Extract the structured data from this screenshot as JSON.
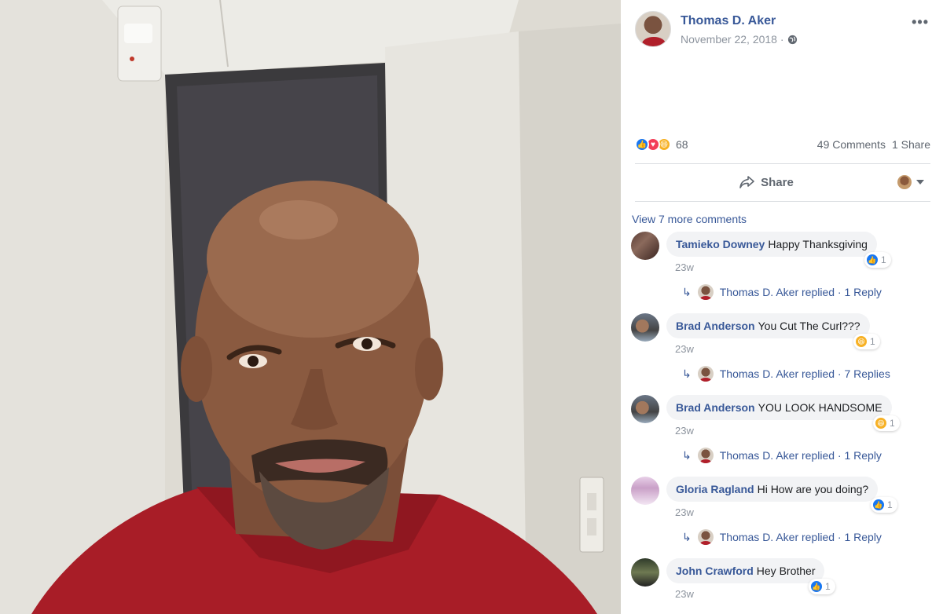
{
  "post": {
    "author": "Thomas D. Aker",
    "date": "November 22, 2018 ·",
    "more_label": "•••",
    "reaction_count": "68",
    "comments_count": "49 Comments",
    "shares_count": "1 Share",
    "share_label": "Share"
  },
  "comments_section": {
    "view_more": "View 7 more comments",
    "items": [
      {
        "name": "Tamieko Downey",
        "text": "Happy Thanksgiving",
        "time": "23w",
        "reaction": "like",
        "reaction_count": "1",
        "reply_text": "Thomas D. Aker replied · 1 Reply"
      },
      {
        "name": "Brad Anderson",
        "text": "You Cut The Curl???",
        "time": "23w",
        "reaction": "haha",
        "reaction_count": "1",
        "reply_text": "Thomas D. Aker replied · 7 Replies"
      },
      {
        "name": "Brad Anderson",
        "text": "YOU LOOK HANDSOME",
        "time": "23w",
        "reaction": "haha",
        "reaction_count": "1",
        "reply_text": "Thomas D. Aker replied · 1 Reply"
      },
      {
        "name": "Gloria Ragland",
        "text": "Hi How are you doing?",
        "time": "23w",
        "reaction": "like",
        "reaction_count": "1",
        "reply_text": "Thomas D. Aker replied · 1 Reply"
      },
      {
        "name": "John Crawford",
        "text": "Hey Brother",
        "time": "23w",
        "reaction": "like",
        "reaction_count": "1"
      }
    ]
  },
  "colors": {
    "link_blue": "#385898",
    "like_blue": "#1877f2",
    "love_red": "#f33e58",
    "haha_yellow": "#f7b125",
    "shirt_red": "#b01f2a"
  },
  "icons": [
    "globe-icon",
    "more-icon",
    "like-icon",
    "love-icon",
    "haha-icon",
    "share-icon",
    "caret-down-icon",
    "reply-arrow-icon"
  ]
}
